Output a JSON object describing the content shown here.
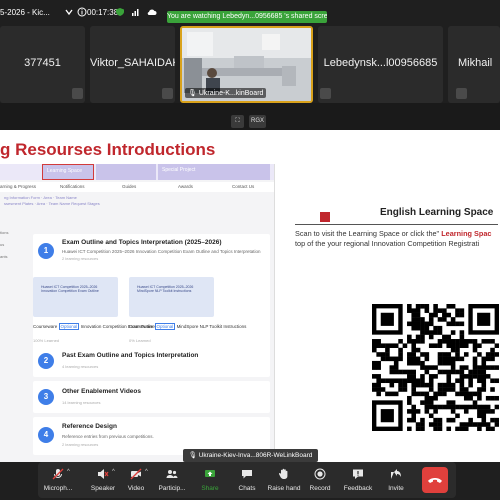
{
  "topbar": {
    "title": "5-2026 - Kic...",
    "timer": "00:17:38",
    "banner": "You are watching Lebedyn...0956685 's shared screen"
  },
  "participants": [
    {
      "name": "377451"
    },
    {
      "name": "Viktor_SAHAIDAK (Me)"
    },
    {
      "name": "Ukraine-K...kinBoard",
      "type": "video"
    },
    {
      "name": "Lebedynsk...l00956685"
    },
    {
      "name": "Mikhail"
    }
  ],
  "share_controls": {
    "fit_label": "RGX"
  },
  "slide": {
    "title": "g Resourses Introductions",
    "screenshot": {
      "tabs": [
        "Learning Space",
        "Special Project"
      ],
      "menu": [
        "arning & Progress",
        "Notifications",
        "Guides",
        "Awards",
        "Contact Us"
      ],
      "crumbs": [
        "ng Information Form · Area · Team Name",
        "ssesment Plates · Area · Team Name Request Stages"
      ],
      "side": [
        "tions",
        "us",
        "ants"
      ],
      "cards": [
        {
          "num": "1",
          "title": "Exam Outline and Topics Interpretation (2025–2026)",
          "subtitle": "Huawei ICT Competition 2025–2026 Innovation Competition Exam Outline and Topics Interpretation",
          "meta": "2 learning resources",
          "items": [
            {
              "thumb": "Huawei ICT Competition 2025–2026 Innovation Competition Exam Outline",
              "kind": "Courseware",
              "tag": "Optional",
              "label": "Innovation Competition Exam Outline",
              "progress": "100% Learned"
            },
            {
              "thumb": "Huawei ICT Competition 2025–2026 MindSpore NLP Toolkit Instructions",
              "kind": "Courseware",
              "tag": "Optional",
              "label": "MindSpore NLP Toolkit Instructions",
              "progress": "0% Learned"
            }
          ]
        },
        {
          "num": "2",
          "title": "Past Exam Outline and Topics Interpretation",
          "meta": "4 learning resources"
        },
        {
          "num": "3",
          "title": "Other Enablement Videos",
          "meta": "14 learning resources"
        },
        {
          "num": "4",
          "title": "Reference Design",
          "subtitle": "Reference entries from previous competitions.",
          "meta": "2 learning resources"
        }
      ]
    },
    "right": {
      "heading": "English Learning Space",
      "text1": "Scan to visit the Learning Space or click the\"",
      "link": "Learning Spac",
      "text2": "top of the your regional Innovation Competition Registrati"
    }
  },
  "video_label": "Ukraine-Kiev-Inva...806R-WeLinkBoard",
  "toolbar": {
    "items": [
      {
        "label": "Microph...",
        "icon": "microphone-icon"
      },
      {
        "label": "Speaker",
        "icon": "speaker-icon"
      },
      {
        "label": "Video",
        "icon": "video-camera-icon"
      },
      {
        "label": "Particip...",
        "icon": "participants-icon"
      },
      {
        "label": "Share",
        "icon": "share-icon"
      },
      {
        "label": "Chats",
        "icon": "chat-icon"
      },
      {
        "label": "Raise hand",
        "icon": "raise-hand-icon"
      },
      {
        "label": "Record",
        "icon": "record-icon"
      },
      {
        "label": "Feedback",
        "icon": "feedback-icon"
      },
      {
        "label": "Invite",
        "icon": "invite-icon"
      }
    ],
    "share_color": "#3aa33a",
    "end_color": "#e0403c"
  }
}
